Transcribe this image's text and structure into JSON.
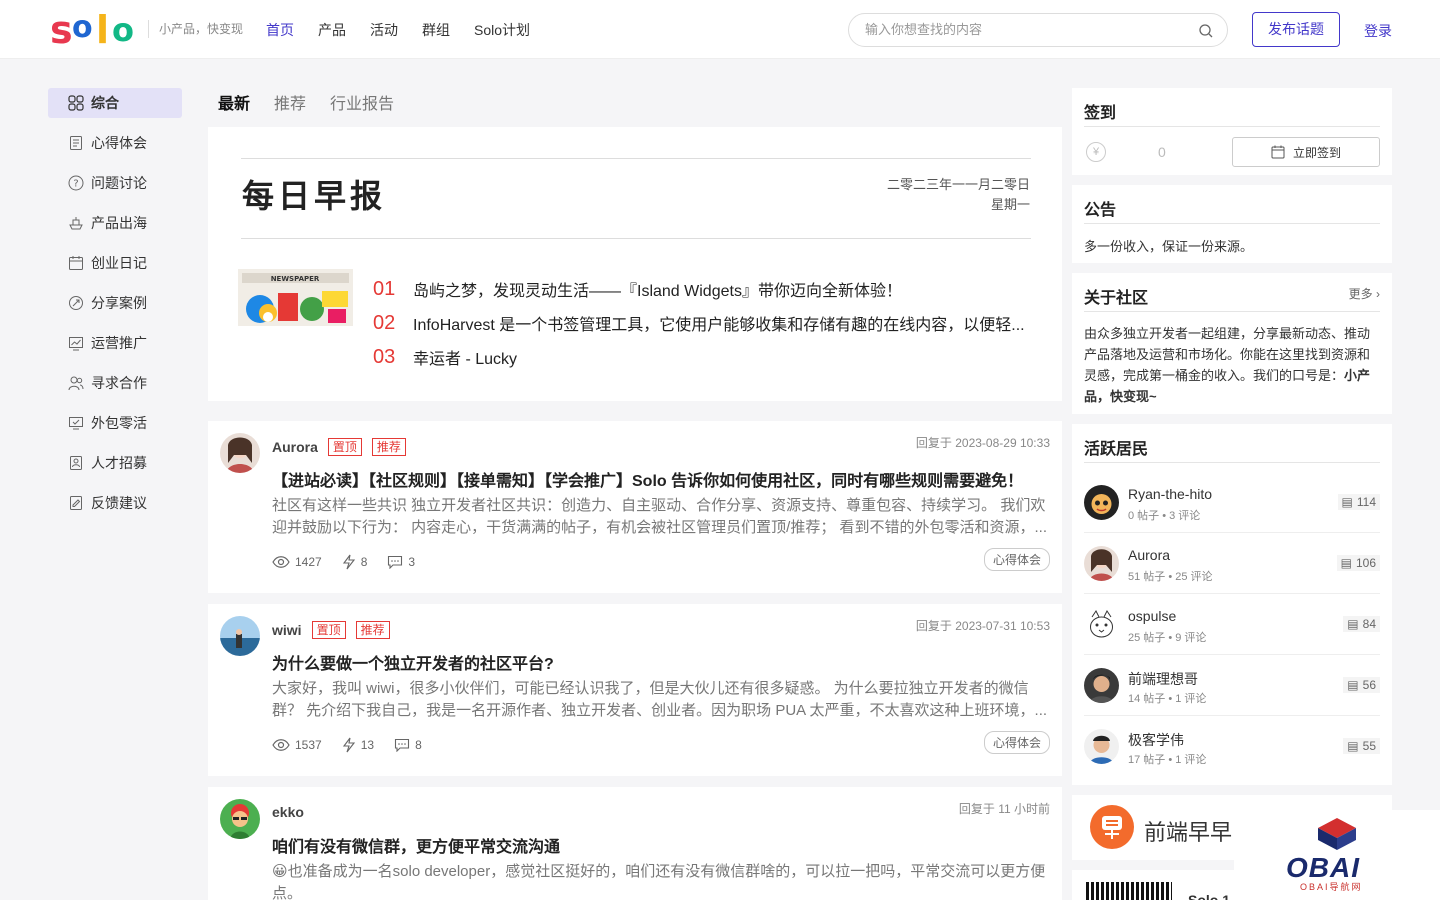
{
  "header": {
    "logo_letters": [
      "s",
      "o",
      "l",
      "o"
    ],
    "logo_colors": [
      "#e8384f",
      "#1f66d1",
      "#f5b41a",
      "#12b886"
    ],
    "slogan": "小产品，快变现",
    "nav": [
      {
        "label": "首页",
        "active": true
      },
      {
        "label": "产品",
        "active": false
      },
      {
        "label": "活动",
        "active": false
      },
      {
        "label": "群组",
        "active": false
      },
      {
        "label": "Solo计划",
        "active": false
      }
    ],
    "search_placeholder": "输入你想查找的内容",
    "post_button": "发布话题",
    "login": "登录",
    "accent": "#4338ca"
  },
  "sidebar": {
    "items": [
      {
        "label": "综合",
        "icon": "grid-icon"
      },
      {
        "label": "心得体会",
        "icon": "document-icon"
      },
      {
        "label": "问题讨论",
        "icon": "question-icon"
      },
      {
        "label": "产品出海",
        "icon": "ship-icon"
      },
      {
        "label": "创业日记",
        "icon": "calendar-icon"
      },
      {
        "label": "分享案例",
        "icon": "share-icon"
      },
      {
        "label": "运营推广",
        "icon": "chart-icon"
      },
      {
        "label": "寻求合作",
        "icon": "users-icon"
      },
      {
        "label": "外包零活",
        "icon": "monitor-icon"
      },
      {
        "label": "人才招募",
        "icon": "person-card-icon"
      },
      {
        "label": "反馈建议",
        "icon": "feedback-icon"
      }
    ]
  },
  "tabs": [
    "最新",
    "推荐",
    "行业报告"
  ],
  "daily": {
    "title": "每日早报",
    "date": "二零二三年一一月二零日",
    "weekday": "星期一",
    "items": [
      {
        "num": "01",
        "text": "岛屿之梦，发现灵动生活——『Island Widgets』带你迈向全新体验！"
      },
      {
        "num": "02",
        "text": "InfoHarvest 是一个书签管理工具，它使用户能够收集和存储有趣的在线内容，以便轻..."
      },
      {
        "num": "03",
        "text": "幸运者 - Lucky"
      }
    ]
  },
  "posts": [
    {
      "author": "Aurora",
      "tags": [
        "置顶",
        "推荐"
      ],
      "time": "回复于 2023-08-29 10:33",
      "title": "【进站必读】【社区规则】【接单需知】【学会推广】Solo 告诉你如何使用社区，同时有哪些规则需要避免！",
      "body": "社区有这样一些共识 独立开发者社区共识：创造力、自主驱动、合作分享、资源支持、尊重包容、持续学习。 我们欢迎并鼓励以下行为： 内容走心，干货满满的帖子，有机会被社区管理员们置顶/推荐； 看到不错的外包零活和资源，...",
      "views": "1427",
      "likes": "8",
      "comments": "3",
      "category": "心得体会"
    },
    {
      "author": "wiwi",
      "tags": [
        "置顶",
        "推荐"
      ],
      "time": "回复于 2023-07-31 10:53",
      "title": "为什么要做一个独立开发者的社区平台?",
      "body": "大家好，我叫 wiwi，很多小伙伴们，可能已经认识我了，但是大伙儿还有很多疑惑。 为什么要拉独立开发者的微信群？ 先介绍下我自己，我是一名开源作者、独立开发者、创业者。因为职场 PUA 太严重，不太喜欢这种上班环境，...",
      "views": "1537",
      "likes": "13",
      "comments": "8",
      "category": "心得体会"
    },
    {
      "author": "ekko",
      "tags": [],
      "time": "回复于 11 小时前",
      "title": "咱们有没有微信群，更方便平常交流沟通",
      "body": "😀也准备成为一名solo developer，感觉社区挺好的，咱们还有没有微信群啥的，可以拉一把吗，平常交流可以更方便点。",
      "views": "",
      "likes": "",
      "comments": "",
      "category": ""
    }
  ],
  "right": {
    "signin": {
      "title": "签到",
      "count": "0",
      "button": "立即签到"
    },
    "notice": {
      "title": "公告",
      "text": "多一份收入，保证一份来源。"
    },
    "about": {
      "title": "关于社区",
      "more": "更多",
      "text": "由众多独立开发者一起组建，分享最新动态、推动产品落地及运营和市场化。你能在这里找到资源和灵感，完成第一桶金的收入。我们的口号是：",
      "slogan": "小产品，快变现~"
    },
    "active": {
      "title": "活跃居民",
      "users": [
        {
          "name": "Ryan-the-hito",
          "meta": "0 帖子 • 3 评论",
          "score": "114"
        },
        {
          "name": "Aurora",
          "meta": "51 帖子 • 25 评论",
          "score": "106"
        },
        {
          "name": "ospulse",
          "meta": "25 帖子 • 9 评论",
          "score": "84"
        },
        {
          "name": "前端理想哥",
          "meta": "14 帖子 • 1 评论",
          "score": "56"
        },
        {
          "name": "极客学伟",
          "meta": "17 帖子 • 1 评论",
          "score": "55"
        }
      ]
    },
    "ad": {
      "text": "前端早早"
    },
    "qr": {
      "text": "Solo 1"
    }
  },
  "watermark": {
    "brand": "OBAI",
    "sub": "OBAI导航网"
  }
}
